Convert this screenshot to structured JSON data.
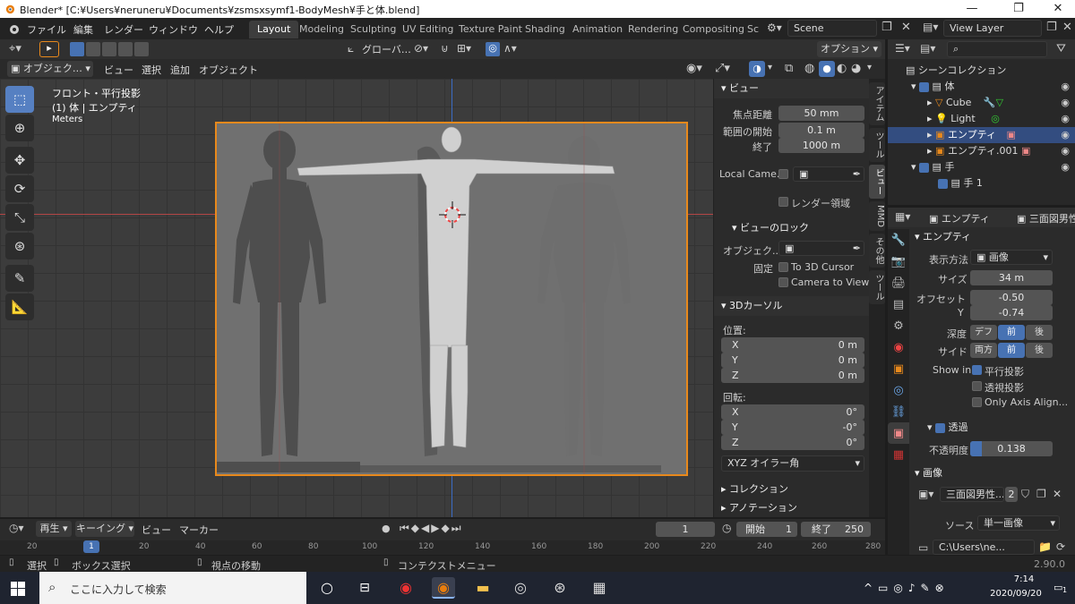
{
  "window": {
    "title": "Blender* [C:¥Users¥neruneru¥Documents¥zsmsxsymf1-BodyMesh¥手と体.blend]",
    "minimize": "—",
    "maximize": "❐",
    "close": "✕"
  },
  "menu": [
    "ファイル",
    "編集",
    "レンダー",
    "ウィンドウ",
    "ヘルプ"
  ],
  "workspaces": [
    "Layout",
    "Modeling",
    "Sculpting",
    "UV Editing",
    "Texture Paint",
    "Shading",
    "Animation",
    "Rendering",
    "Compositing",
    "Sc"
  ],
  "active_workspace": "Layout",
  "scene": {
    "value": "Scene"
  },
  "view_layer": {
    "value": "View Layer"
  },
  "vp_header": {
    "transform": "グローバ…",
    "options": "オプション"
  },
  "vp_header2": {
    "mode": "オブジェク…",
    "items": [
      "ビュー",
      "選択",
      "追加",
      "オブジェクト"
    ]
  },
  "viewport": {
    "view_name": "フロント・平行投影",
    "object_info": "(1) 体 | エンプティ",
    "units": "Meters"
  },
  "tools": [
    "select",
    "cursor",
    "move",
    "rotate",
    "scale",
    "transform",
    "annotate",
    "measure"
  ],
  "sidebar": {
    "view_header": "ビュー",
    "focal": {
      "label": "焦点距離",
      "value": "50 mm"
    },
    "clip_start": {
      "label": "範囲の開始",
      "value": "0.1 m"
    },
    "clip_end": {
      "label": "終了",
      "value": "1000 m"
    },
    "local_camera": "Local Came...",
    "render_region": "レンダー領域",
    "lock_header": "ビューのロック",
    "lock_object": "オブジェク...",
    "lock_label": "固定",
    "to_3d_cursor": "To 3D Cursor",
    "camera_to_view": "Camera to View",
    "cursor_header": "3Dカーソル",
    "position": "位置:",
    "loc": [
      {
        "axis": "X",
        "value": "0 m"
      },
      {
        "axis": "Y",
        "value": "0 m"
      },
      {
        "axis": "Z",
        "value": "0 m"
      }
    ],
    "rotation": "回転:",
    "rot": [
      {
        "axis": "X",
        "value": "0°"
      },
      {
        "axis": "Y",
        "value": "-0°"
      },
      {
        "axis": "Z",
        "value": "0°"
      }
    ],
    "rot_mode": "XYZ オイラー角",
    "collection": "コレクション",
    "annotation": "アノテーション"
  },
  "vtabs": [
    "アイテム",
    "ツール",
    "ビュー",
    "MMD",
    "その他",
    "ツール"
  ],
  "outliner": {
    "root": "シーンコレクション",
    "rows": [
      {
        "name": "体",
        "indent": 1
      },
      {
        "name": "Cube",
        "indent": 2
      },
      {
        "name": "Light",
        "indent": 2
      },
      {
        "name": "エンプティ",
        "indent": 2,
        "selected": true
      },
      {
        "name": "エンプティ.001",
        "indent": 2
      },
      {
        "name": "手",
        "indent": 1
      },
      {
        "name": "手 1",
        "indent": 2
      }
    ]
  },
  "props": {
    "object": "エンプティ",
    "image_name": "三面図男性",
    "section": "エンプティ",
    "display_as": {
      "label": "表示方法",
      "value": "画像"
    },
    "size": {
      "label": "サイズ",
      "value": "34 m"
    },
    "offset": {
      "label": "オフセット",
      "x": "-0.50",
      "y_label": "Y",
      "y": "-0.74"
    },
    "depth": {
      "label": "深度",
      "options": [
        "デフ",
        "前",
        "後"
      ],
      "active": "前"
    },
    "side": {
      "label": "サイド",
      "options": [
        "両方",
        "前",
        "後"
      ],
      "active": "前"
    },
    "show_in": "Show in",
    "ortho": "平行投影",
    "persp": "透視投影",
    "axis_align": "Only Axis Align...",
    "transp": "透過",
    "opacity": {
      "label": "不透明度",
      "value": "0.138",
      "fraction": 0.138
    },
    "image_header": "画像",
    "image_field": "三面図男性...",
    "users": "2",
    "source": {
      "label": "ソース",
      "value": "単一画像"
    },
    "path": "C:\\Users\\ne..."
  },
  "timeline": {
    "playback": "再生",
    "keying": "キーイング",
    "view": "ビュー",
    "marker": "マーカー",
    "frame": "1",
    "start_label": "開始",
    "start": "1",
    "end_label": "終了",
    "end": "250",
    "ticks": [
      "20",
      "1",
      "20",
      "40",
      "60",
      "80",
      "100",
      "120",
      "140",
      "160",
      "180",
      "200",
      "220",
      "240",
      "260",
      "280"
    ]
  },
  "status": {
    "select": "選択",
    "box": "ボックス選択",
    "move": "視点の移動",
    "context": "コンテクストメニュー",
    "version": "2.90.0"
  },
  "taskbar": {
    "search": "ここに入力して検索",
    "time": "7:14",
    "date": "2020/09/20",
    "notif": "1"
  }
}
